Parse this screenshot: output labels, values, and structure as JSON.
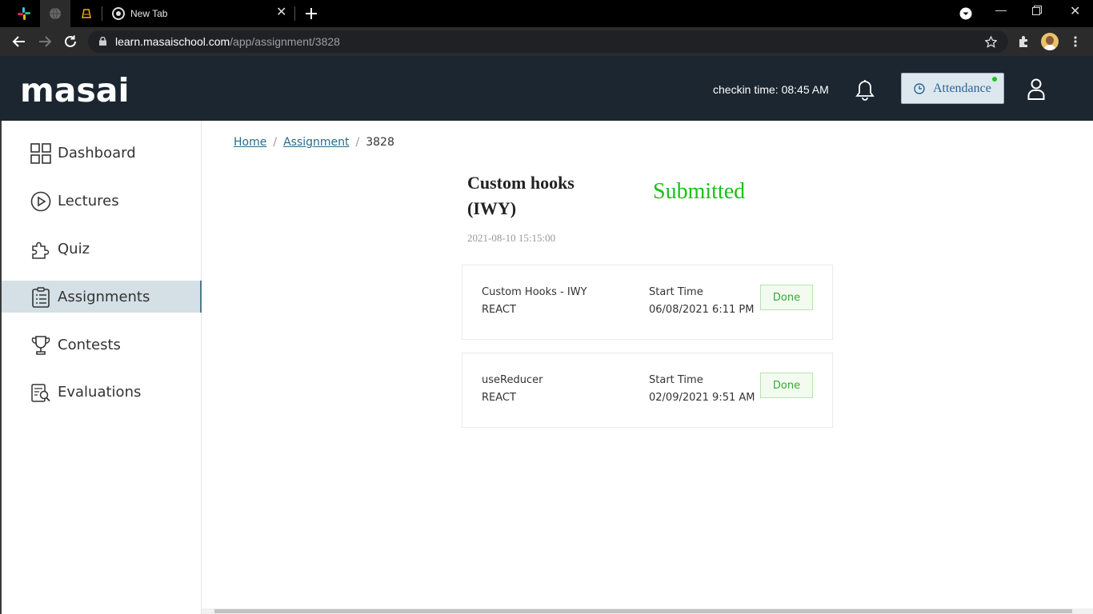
{
  "browser": {
    "tab_title": "New Tab",
    "url_host": "learn.masaischool.com",
    "url_path": "/app/assignment/3828"
  },
  "header": {
    "logo_text": "masai",
    "checkin": "checkin time: 08:45 AM",
    "attendance_label": "Attendance"
  },
  "sidebar": {
    "items": [
      {
        "label": "Dashboard",
        "icon": "dashboard-icon"
      },
      {
        "label": "Lectures",
        "icon": "play-circle-icon"
      },
      {
        "label": "Quiz",
        "icon": "puzzle-icon"
      },
      {
        "label": "Assignments",
        "icon": "clipboard-icon",
        "active": true
      },
      {
        "label": "Contests",
        "icon": "trophy-icon"
      },
      {
        "label": "Evaluations",
        "icon": "evaluation-icon"
      }
    ]
  },
  "breadcrumb": {
    "home": "Home",
    "assignment": "Assignment",
    "current": "3828",
    "separator": "/"
  },
  "assignment": {
    "title": "Custom hooks (IWY)",
    "status": "Submitted",
    "date": "2021-08-10 15:15:00",
    "items": [
      {
        "name": "Custom Hooks - IWY",
        "track": "REACT",
        "start_label": "Start Time",
        "start_time": "06/08/2021 6:11 PM",
        "action": "Done"
      },
      {
        "name": "useReducer",
        "track": "REACT",
        "start_label": "Start Time",
        "start_time": "02/09/2021 9:51 AM",
        "action": "Done"
      }
    ]
  },
  "colors": {
    "header_bg": "#1b2630",
    "status_green": "#19c019",
    "active_nav_bg": "#d4e0e6",
    "link": "#2a6a8a"
  }
}
